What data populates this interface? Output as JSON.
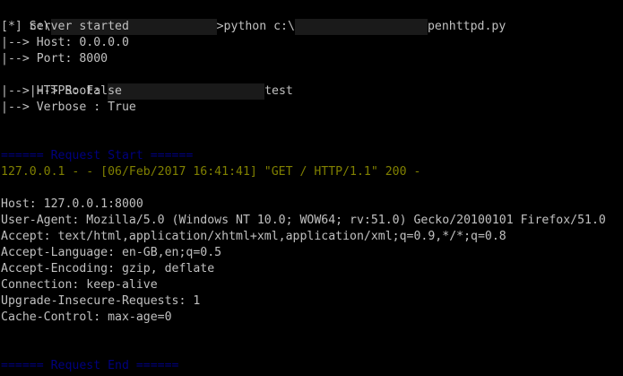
{
  "terminal": {
    "cmd": {
      "prefix": "c:\\",
      "middle": ">python c:\\",
      "suffix": "penhttpd.py"
    },
    "banner": {
      "started": "[*] Server started",
      "host": "|--> Host: 0.0.0.0",
      "port": "|--> Port: 8000",
      "root_prefix": "|--> Root: ",
      "root_suffix": "test",
      "https": "|--> HTTPS: False",
      "verbose": "|--> Verbose : True"
    },
    "request_start": "====== Request Start ======",
    "access_log": "127.0.0.1 - - [06/Feb/2017 16:41:41] \"GET / HTTP/1.1\" 200 -",
    "headers": [
      "Host: 127.0.0.1:8000",
      "User-Agent: Mozilla/5.0 (Windows NT 10.0; WOW64; rv:51.0) Gecko/20100101 Firefox/51.0",
      "Accept: text/html,application/xhtml+xml,application/xml;q=0.9,*/*;q=0.8",
      "Accept-Language: en-GB,en;q=0.5",
      "Accept-Encoding: gzip, deflate",
      "Connection: keep-alive",
      "Upgrade-Insecure-Requests: 1",
      "Cache-Control: max-age=0"
    ],
    "request_end": "====== Request End ======"
  },
  "colors": {
    "background": "#000000",
    "text": "#c0c0c0",
    "separator": "#000080",
    "log": "#808000"
  }
}
